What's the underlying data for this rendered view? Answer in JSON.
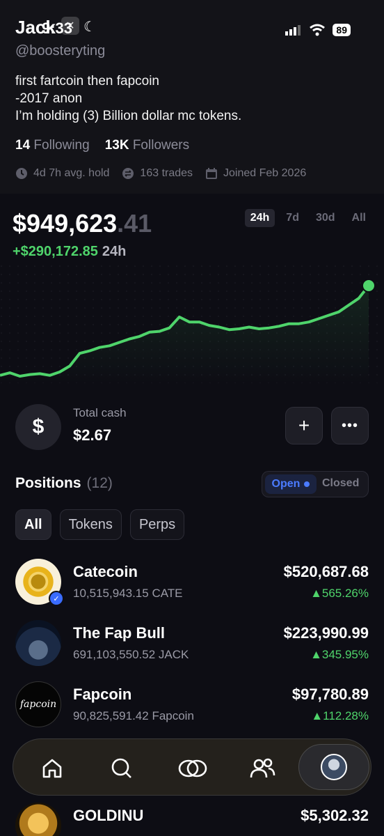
{
  "status": {
    "time": "9:33",
    "battery": "89"
  },
  "profile": {
    "display_name": "Jack",
    "handle": "@boosteryting",
    "bio_lines": [
      "first fartcoin then fapcoin",
      "-2017 anon",
      "I’m holding (3) Billion dollar mc tokens."
    ],
    "following_count": "14",
    "following_label": "Following",
    "followers_count": "13K",
    "followers_label": "Followers",
    "avg_hold": "4d 7h avg. hold",
    "trades": "163 trades",
    "joined": "Joined Feb 2026"
  },
  "portfolio": {
    "balance_main": "$949,623",
    "balance_decimal": ".41",
    "change": "+$290,172.85",
    "change_period": "24h",
    "ranges": [
      "24h",
      "7d",
      "30d",
      "All"
    ],
    "active_range": "24h"
  },
  "chart_data": {
    "type": "line",
    "x": [
      0,
      1,
      2,
      3,
      4,
      5,
      6,
      7,
      8,
      9,
      10,
      11,
      12,
      13,
      14,
      15,
      16,
      17,
      18,
      19,
      20,
      21,
      22,
      23,
      24,
      25,
      26,
      27,
      28,
      29,
      30,
      31,
      32,
      33,
      34,
      35,
      36,
      37,
      38,
      39,
      40
    ],
    "values": [
      949,
      952,
      948,
      950,
      951,
      949,
      953,
      960,
      975,
      978,
      982,
      984,
      988,
      992,
      995,
      1000,
      1001,
      1005,
      1018,
      1012,
      1012,
      1008,
      1006,
      1003,
      1004,
      1006,
      1004,
      1005,
      1007,
      1010,
      1010,
      1012,
      1016,
      1020,
      1024,
      1032,
      1040,
      1055
    ],
    "colors": {
      "line": "#4fd46b"
    }
  },
  "cash": {
    "label": "Total cash",
    "value": "$2.67",
    "icon": "dollar-icon",
    "add_label": "+",
    "more_label": "•••"
  },
  "positions": {
    "title": "Positions",
    "count": "(12)",
    "toggle_open": "Open",
    "toggle_closed": "Closed",
    "filters": [
      "All",
      "Tokens",
      "Perps"
    ],
    "items": [
      {
        "name": "Catecoin",
        "amount": "10,515,943.15 CATE",
        "value": "$520,687.68",
        "change": "▲565.26%"
      },
      {
        "name": "The Fap Bull",
        "amount": "691,103,550.52 JACK",
        "value": "$223,990.99",
        "change": "▲345.95%"
      },
      {
        "name": "Fapcoin",
        "amount": "90,825,591.42 Fapcoin",
        "value": "$97,780.89",
        "change": "▲112.28%"
      },
      {
        "name": "GOLDINU",
        "amount": "",
        "value": "$5,302.32",
        "change": ""
      }
    ]
  },
  "nav": {
    "items": [
      "home-icon",
      "search-icon",
      "swap-icon",
      "people-icon",
      "profile-avatar"
    ]
  }
}
